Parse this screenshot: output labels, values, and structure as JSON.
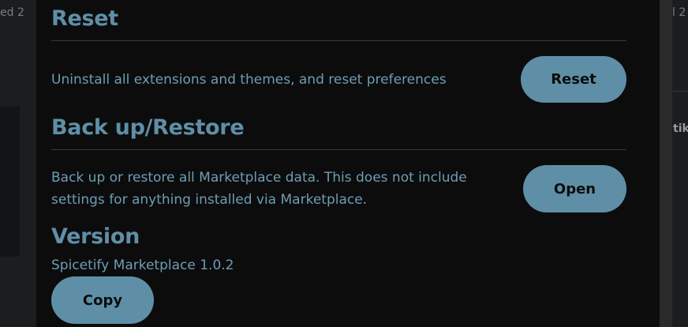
{
  "background": {
    "left_text": "ed 2",
    "right_text": "l 2",
    "right_text2": "tik"
  },
  "sections": {
    "reset": {
      "title": "Reset",
      "description": "Uninstall all extensions and themes, and reset preferences",
      "button_label": "Reset"
    },
    "backup": {
      "title": "Back up/Restore",
      "description": "Back up or restore all Marketplace data. This does not include settings for anything installed via Marketplace.",
      "button_label": "Open"
    },
    "version": {
      "title": "Version",
      "value": "Spicetify Marketplace 1.0.2",
      "button_label": "Copy"
    }
  },
  "colors": {
    "accent": "#5f8fa6",
    "background": "#0c0c0d",
    "text": "#6e9db3"
  }
}
